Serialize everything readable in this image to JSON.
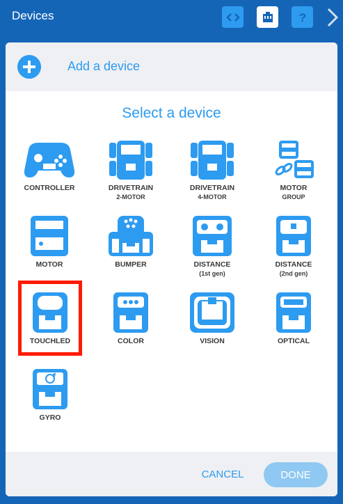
{
  "topbar": {
    "title": "Devices",
    "buttons": [
      "code-icon",
      "port-icon",
      "help-icon",
      "chevron-right-icon"
    ]
  },
  "add_device": {
    "label": "Add a device"
  },
  "select_title": "Select a device",
  "devices": [
    {
      "label": "CONTROLLER",
      "sub": ""
    },
    {
      "label": "DRIVETRAIN",
      "sub": "2-MOTOR"
    },
    {
      "label": "DRIVETRAIN",
      "sub": "4-MOTOR"
    },
    {
      "label": "MOTOR",
      "sub": "GROUP"
    },
    {
      "label": "MOTOR",
      "sub": ""
    },
    {
      "label": "BUMPER",
      "sub": ""
    },
    {
      "label": "DISTANCE",
      "sub": "(1st gen)"
    },
    {
      "label": "DISTANCE",
      "sub": "(2nd gen)"
    },
    {
      "label": "TOUCHLED",
      "sub": ""
    },
    {
      "label": "COLOR",
      "sub": ""
    },
    {
      "label": "VISION",
      "sub": ""
    },
    {
      "label": "OPTICAL",
      "sub": ""
    },
    {
      "label": "GYRO",
      "sub": ""
    }
  ],
  "footer": {
    "cancel": "CANCEL",
    "done": "DONE"
  },
  "colors": {
    "accent": "#2d9bf0",
    "topbar": "#1565b7",
    "highlight": "#ff1a00"
  }
}
